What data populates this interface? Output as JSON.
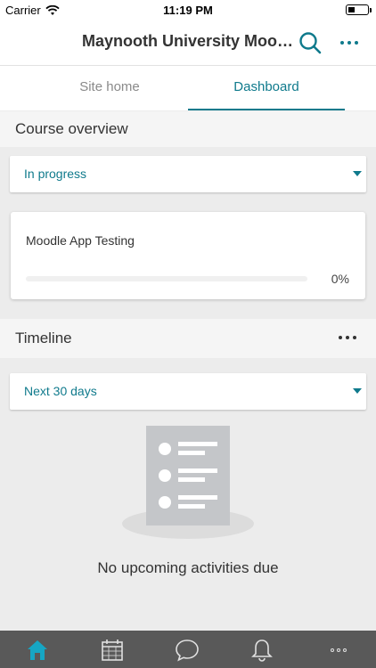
{
  "status_bar": {
    "carrier": "Carrier",
    "time": "11:19 PM"
  },
  "header": {
    "title": "Maynooth University Moodl...",
    "search_icon": "search-icon",
    "more_icon": "more-dots-icon"
  },
  "tabs": [
    {
      "label": "Site home",
      "active": false
    },
    {
      "label": "Dashboard",
      "active": true
    }
  ],
  "course_overview": {
    "title": "Course overview",
    "filter_value": "In progress",
    "courses": [
      {
        "name": "Moodle App Testing",
        "progress_percent": 0,
        "progress_label": "0%"
      }
    ]
  },
  "timeline": {
    "title": "Timeline",
    "filter_value": "Next 30 days",
    "empty_message": "No upcoming activities due"
  },
  "bottom_nav": [
    {
      "name": "home-icon",
      "active": true
    },
    {
      "name": "calendar-icon",
      "active": false
    },
    {
      "name": "messages-icon",
      "active": false
    },
    {
      "name": "bell-icon",
      "active": false
    },
    {
      "name": "more-icon",
      "active": false
    }
  ],
  "colors": {
    "accent": "#0f7a8c",
    "background": "#ececec",
    "tabbar": "#595959"
  }
}
